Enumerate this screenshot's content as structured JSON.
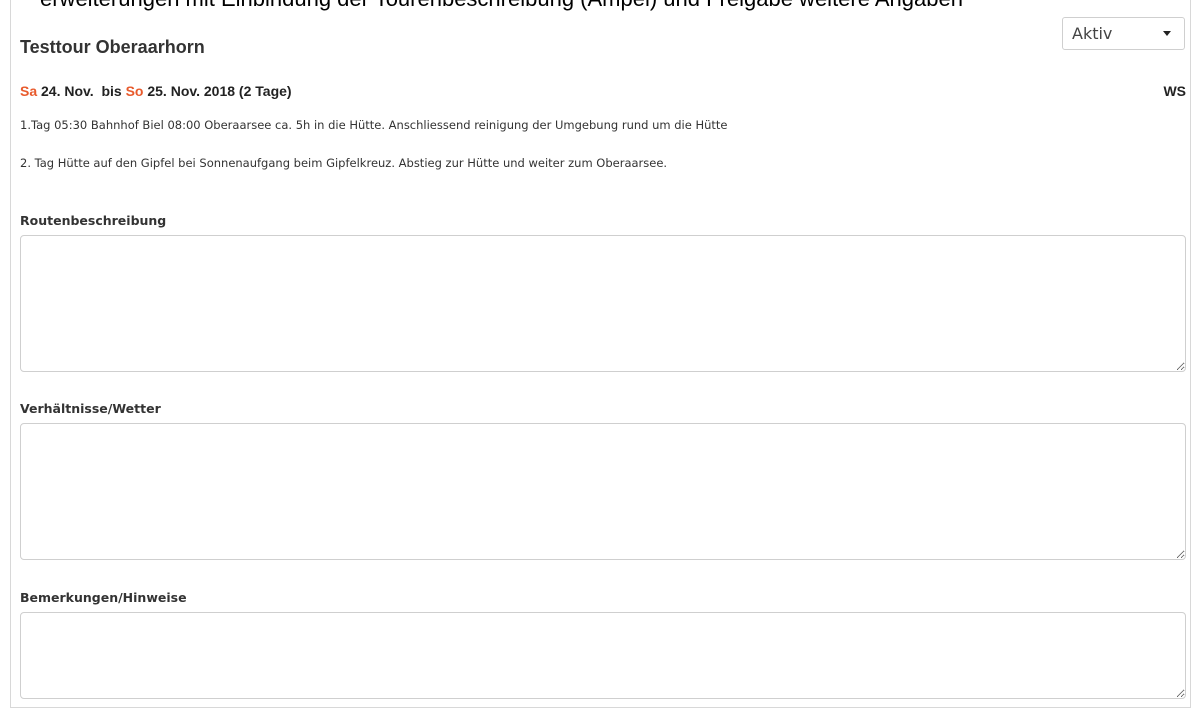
{
  "top_fragment": "erweiterungen mit Einbindung der Tourenbeschreibung (Ampel) und Freigabe weitere Angaben",
  "tour": {
    "title": "Testtour Oberaarhorn",
    "status": "Aktiv",
    "start_day": "Sa",
    "start_date": "24. Nov.",
    "until": "bis",
    "end_day": "So",
    "end_date": "25. Nov. 2018 (2 Tage)",
    "difficulty": "WS",
    "description_line1": "1.Tag 05:30 Bahnhof Biel 08:00 Oberaarsee ca. 5h in die Hütte. Anschliessend reinigung der Umgebung rund um die Hütte",
    "description_line2": "2. Tag Hütte auf den Gipfel bei Sonnenaufgang beim Gipfelkreuz. Abstieg zur Hütte und weiter zum Oberaarsee."
  },
  "fields": {
    "route_label": "Routenbeschreibung",
    "route_value": "",
    "weather_label": "Verhältnisse/Wetter",
    "weather_value": "",
    "remarks_label": "Bemerkungen/Hinweise",
    "remarks_value": ""
  },
  "colors": {
    "day_accent": "#e85a2c"
  }
}
